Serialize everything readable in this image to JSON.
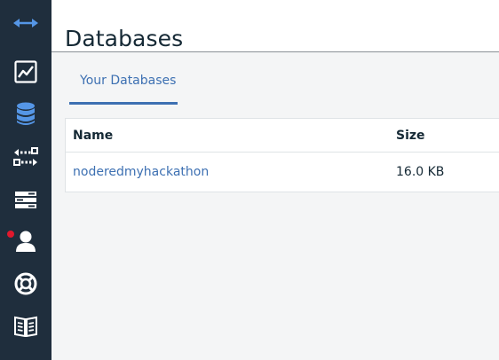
{
  "header": {
    "title": "Databases"
  },
  "tabs": [
    {
      "label": "Your Databases",
      "active": true
    }
  ],
  "table": {
    "columns": [
      "Name",
      "Size"
    ],
    "rows": [
      {
        "name": "noderedmyhackathon",
        "size": "16.0 KB"
      }
    ]
  },
  "sidebar": {
    "items": [
      {
        "icon": "swap-arrows-icon",
        "active": false
      },
      {
        "icon": "activity-chart-icon",
        "active": false
      },
      {
        "icon": "database-icon",
        "active": true
      },
      {
        "icon": "replication-icon",
        "active": false
      },
      {
        "icon": "server-list-icon",
        "active": false
      },
      {
        "icon": "account-icon",
        "active": false,
        "notification": true
      },
      {
        "icon": "support-lifebuoy-icon",
        "active": false
      },
      {
        "icon": "documentation-book-icon",
        "active": false
      }
    ]
  },
  "colors": {
    "sidebar_bg": "#1f2e3d",
    "accent": "#3d70b2",
    "active_icon": "#5596e6",
    "notification": "#e0182d"
  }
}
